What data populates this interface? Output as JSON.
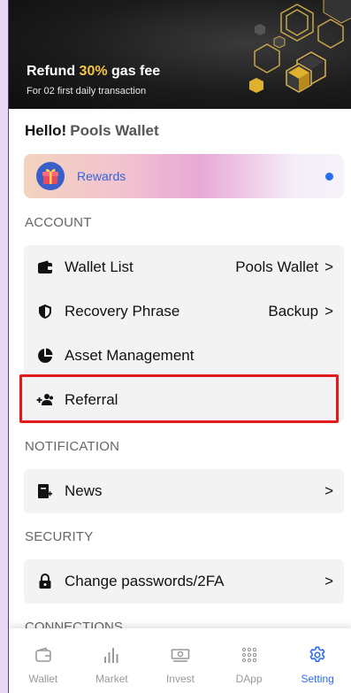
{
  "banner": {
    "title_pre": "Refund ",
    "title_highlight": "30%",
    "title_post": " gas fee",
    "subtitle": "For 02 first daily transaction"
  },
  "greeting": {
    "hello": "Hello!",
    "wallet_name": "Pools Wallet"
  },
  "rewards": {
    "label": "Rewards"
  },
  "account": {
    "header": "ACCOUNT",
    "items": [
      {
        "label": "Wallet List",
        "value": "Pools Wallet",
        "chevron": ">",
        "icon": "wallet-icon"
      },
      {
        "label": "Recovery Phrase",
        "value": "Backup",
        "chevron": ">",
        "icon": "shield-icon"
      },
      {
        "label": "Asset Management",
        "icon": "pie-chart-icon"
      },
      {
        "label": "Referral",
        "icon": "add-users-icon"
      }
    ]
  },
  "notification": {
    "header": "NOTIFICATION",
    "items": [
      {
        "label": "News",
        "chevron": ">",
        "icon": "news-icon"
      }
    ]
  },
  "security": {
    "header": "SECURITY",
    "items": [
      {
        "label": "Change passwords/2FA",
        "chevron": ">",
        "icon": "lock-icon"
      }
    ]
  },
  "connections": {
    "header": "CONNECTIONS"
  },
  "nav": {
    "items": [
      {
        "label": "Wallet",
        "icon": "wallet-outline-icon"
      },
      {
        "label": "Market",
        "icon": "bar-chart-icon"
      },
      {
        "label": "Invest",
        "icon": "money-icon"
      },
      {
        "label": "DApp",
        "icon": "grid-dots-icon"
      },
      {
        "label": "Setting",
        "icon": "gear-icon",
        "active": true
      }
    ]
  },
  "colors": {
    "accent": "#2a6cf0",
    "highlight_box": "#e11b1b",
    "banner_highlight": "#f4c542"
  }
}
